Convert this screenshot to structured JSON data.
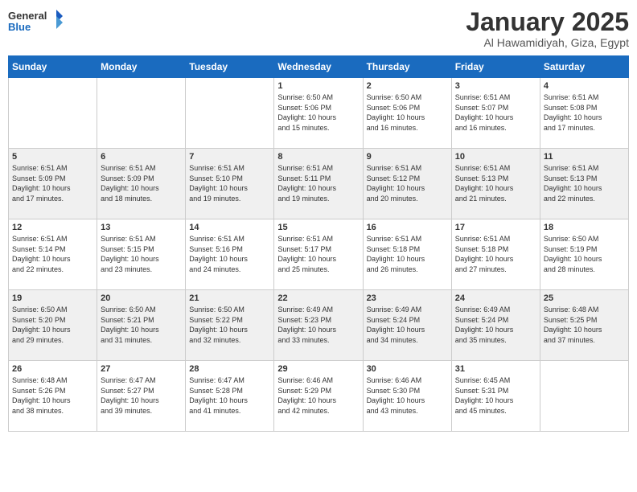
{
  "header": {
    "logo_general": "General",
    "logo_blue": "Blue",
    "title": "January 2025",
    "subtitle": "Al Hawamidiyah, Giza, Egypt"
  },
  "weekdays": [
    "Sunday",
    "Monday",
    "Tuesday",
    "Wednesday",
    "Thursday",
    "Friday",
    "Saturday"
  ],
  "weeks": [
    [
      {
        "day": "",
        "info": ""
      },
      {
        "day": "",
        "info": ""
      },
      {
        "day": "",
        "info": ""
      },
      {
        "day": "1",
        "info": "Sunrise: 6:50 AM\nSunset: 5:06 PM\nDaylight: 10 hours\nand 15 minutes."
      },
      {
        "day": "2",
        "info": "Sunrise: 6:50 AM\nSunset: 5:06 PM\nDaylight: 10 hours\nand 16 minutes."
      },
      {
        "day": "3",
        "info": "Sunrise: 6:51 AM\nSunset: 5:07 PM\nDaylight: 10 hours\nand 16 minutes."
      },
      {
        "day": "4",
        "info": "Sunrise: 6:51 AM\nSunset: 5:08 PM\nDaylight: 10 hours\nand 17 minutes."
      }
    ],
    [
      {
        "day": "5",
        "info": "Sunrise: 6:51 AM\nSunset: 5:09 PM\nDaylight: 10 hours\nand 17 minutes."
      },
      {
        "day": "6",
        "info": "Sunrise: 6:51 AM\nSunset: 5:09 PM\nDaylight: 10 hours\nand 18 minutes."
      },
      {
        "day": "7",
        "info": "Sunrise: 6:51 AM\nSunset: 5:10 PM\nDaylight: 10 hours\nand 19 minutes."
      },
      {
        "day": "8",
        "info": "Sunrise: 6:51 AM\nSunset: 5:11 PM\nDaylight: 10 hours\nand 19 minutes."
      },
      {
        "day": "9",
        "info": "Sunrise: 6:51 AM\nSunset: 5:12 PM\nDaylight: 10 hours\nand 20 minutes."
      },
      {
        "day": "10",
        "info": "Sunrise: 6:51 AM\nSunset: 5:13 PM\nDaylight: 10 hours\nand 21 minutes."
      },
      {
        "day": "11",
        "info": "Sunrise: 6:51 AM\nSunset: 5:13 PM\nDaylight: 10 hours\nand 22 minutes."
      }
    ],
    [
      {
        "day": "12",
        "info": "Sunrise: 6:51 AM\nSunset: 5:14 PM\nDaylight: 10 hours\nand 22 minutes."
      },
      {
        "day": "13",
        "info": "Sunrise: 6:51 AM\nSunset: 5:15 PM\nDaylight: 10 hours\nand 23 minutes."
      },
      {
        "day": "14",
        "info": "Sunrise: 6:51 AM\nSunset: 5:16 PM\nDaylight: 10 hours\nand 24 minutes."
      },
      {
        "day": "15",
        "info": "Sunrise: 6:51 AM\nSunset: 5:17 PM\nDaylight: 10 hours\nand 25 minutes."
      },
      {
        "day": "16",
        "info": "Sunrise: 6:51 AM\nSunset: 5:18 PM\nDaylight: 10 hours\nand 26 minutes."
      },
      {
        "day": "17",
        "info": "Sunrise: 6:51 AM\nSunset: 5:18 PM\nDaylight: 10 hours\nand 27 minutes."
      },
      {
        "day": "18",
        "info": "Sunrise: 6:50 AM\nSunset: 5:19 PM\nDaylight: 10 hours\nand 28 minutes."
      }
    ],
    [
      {
        "day": "19",
        "info": "Sunrise: 6:50 AM\nSunset: 5:20 PM\nDaylight: 10 hours\nand 29 minutes."
      },
      {
        "day": "20",
        "info": "Sunrise: 6:50 AM\nSunset: 5:21 PM\nDaylight: 10 hours\nand 31 minutes."
      },
      {
        "day": "21",
        "info": "Sunrise: 6:50 AM\nSunset: 5:22 PM\nDaylight: 10 hours\nand 32 minutes."
      },
      {
        "day": "22",
        "info": "Sunrise: 6:49 AM\nSunset: 5:23 PM\nDaylight: 10 hours\nand 33 minutes."
      },
      {
        "day": "23",
        "info": "Sunrise: 6:49 AM\nSunset: 5:24 PM\nDaylight: 10 hours\nand 34 minutes."
      },
      {
        "day": "24",
        "info": "Sunrise: 6:49 AM\nSunset: 5:24 PM\nDaylight: 10 hours\nand 35 minutes."
      },
      {
        "day": "25",
        "info": "Sunrise: 6:48 AM\nSunset: 5:25 PM\nDaylight: 10 hours\nand 37 minutes."
      }
    ],
    [
      {
        "day": "26",
        "info": "Sunrise: 6:48 AM\nSunset: 5:26 PM\nDaylight: 10 hours\nand 38 minutes."
      },
      {
        "day": "27",
        "info": "Sunrise: 6:47 AM\nSunset: 5:27 PM\nDaylight: 10 hours\nand 39 minutes."
      },
      {
        "day": "28",
        "info": "Sunrise: 6:47 AM\nSunset: 5:28 PM\nDaylight: 10 hours\nand 41 minutes."
      },
      {
        "day": "29",
        "info": "Sunrise: 6:46 AM\nSunset: 5:29 PM\nDaylight: 10 hours\nand 42 minutes."
      },
      {
        "day": "30",
        "info": "Sunrise: 6:46 AM\nSunset: 5:30 PM\nDaylight: 10 hours\nand 43 minutes."
      },
      {
        "day": "31",
        "info": "Sunrise: 6:45 AM\nSunset: 5:31 PM\nDaylight: 10 hours\nand 45 minutes."
      },
      {
        "day": "",
        "info": ""
      }
    ]
  ]
}
